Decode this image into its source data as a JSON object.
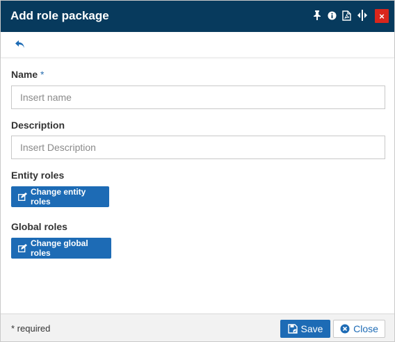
{
  "dialog": {
    "title": "Add role package",
    "header_icons": [
      "pin-icon",
      "info-icon",
      "pdf-icon",
      "resize-icon",
      "close-icon"
    ],
    "close_glyph": "×"
  },
  "toolbar": {
    "back_icon": "back-arrow-icon"
  },
  "form": {
    "name": {
      "label": "Name",
      "required_mark": "*",
      "placeholder": "Insert name",
      "value": ""
    },
    "description": {
      "label": "Description",
      "placeholder": "Insert Description",
      "value": ""
    },
    "entity_roles": {
      "label": "Entity roles",
      "button_label": "Change entity roles",
      "button_icon": "edit-icon"
    },
    "global_roles": {
      "label": "Global roles",
      "button_label": "Change global roles",
      "button_icon": "edit-icon"
    }
  },
  "footer": {
    "required_note": "* required",
    "save_label": "Save",
    "save_icon": "save-icon",
    "close_label": "Close",
    "close_icon": "close-circle-icon"
  },
  "colors": {
    "header_bg": "#073a5d",
    "accent": "#1d6bb5",
    "close_red": "#d9261c",
    "footer_bg": "#f2f2f2"
  }
}
